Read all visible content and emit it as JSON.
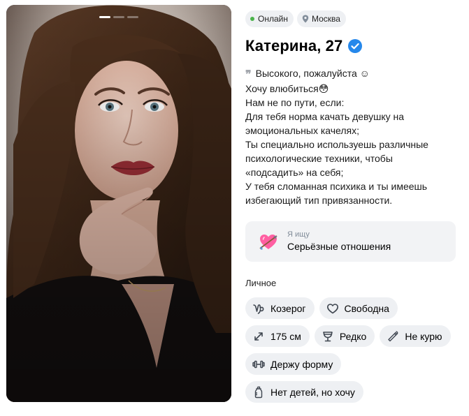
{
  "status": {
    "online": "Онлайн",
    "city": "Москва"
  },
  "profile": {
    "name_age": "Катерина, 27"
  },
  "bio": {
    "lines": [
      "Высокого, пожалуйста ☺",
      "Хочу влюбиться😳",
      "Нам не по пути, если:",
      "Для тебя норма качать девушку на",
      "эмоциональных качелях;",
      "Ты специально используешь различные",
      "психологические техники, чтобы",
      "«подсадить» на себя;",
      "У тебя сломанная психика и ты имеешь",
      "избегающий тип привязанности."
    ]
  },
  "looking_for": {
    "label": "Я ищу",
    "value": "Серьёзные отношения"
  },
  "personal": {
    "title": "Личное",
    "tags": [
      {
        "icon": "zodiac-capricorn-icon",
        "label": "Козерог"
      },
      {
        "icon": "heart-icon",
        "label": "Свободна"
      },
      {
        "icon": "height-icon",
        "label": "175 см"
      },
      {
        "icon": "drink-glass-icon",
        "label": "Редко"
      },
      {
        "icon": "no-smoking-icon",
        "label": "Не курю"
      },
      {
        "icon": "dumbbell-icon",
        "label": "Держу форму"
      },
      {
        "icon": "baby-bottle-icon",
        "label": "Нет детей, но хочу"
      }
    ]
  },
  "photos": {
    "count": 3,
    "current": 1
  },
  "colors": {
    "accent": "#2688eb",
    "online": "#4bb34b",
    "chip_bg": "#eef0f3",
    "card_bg": "#f2f3f5"
  }
}
